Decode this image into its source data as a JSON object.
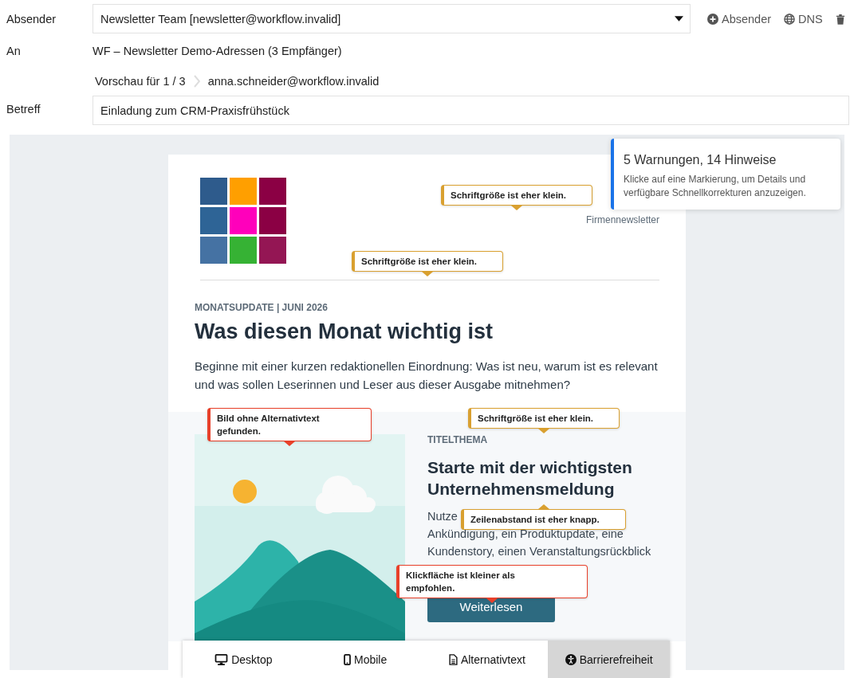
{
  "form": {
    "sender_label": "Absender",
    "sender_value": "Newsletter Team [newsletter@workflow.invalid]",
    "actions": [
      {
        "kind": "add",
        "label": "Absender"
      },
      {
        "kind": "globe",
        "label": "DNS"
      },
      {
        "kind": "delete"
      }
    ],
    "recipient_label": "An",
    "recipient_value": "WF – Newsletter Demo-Adressen (3 Empfänger)",
    "preview_for": "Vorschau für 1 / 3",
    "preview_address": "anna.schneider@workflow.invalid",
    "subject_label": "Betreff",
    "subject_value": "Einladung zum CRM-Praxisfrühstück"
  },
  "email": {
    "brand_line": "Firmennewsletter",
    "eyebrow": "MONATSUPDATE | JUNI 2026",
    "heading": "Was diesen Monat wichtig ist",
    "intro_lines": [
      "Beginne mit einer kurzen redaktionellen Einordnung: Was ist neu, warum ist es relevant",
      "und was sollen Leserinnen und Leser aus dieser Ausgabe mitnehmen?"
    ],
    "feature": {
      "image": {
        "kind": "picture"
      },
      "eyebrow": "TITELTHEMA",
      "heading": "Starte mit der wichtigsten Unternehmensmeldung",
      "body_lines": [
        "Nutze",
        "Ankündigung, ein Produktupdate, eine",
        "Kundenstory, einen Veranstaltungsrückblick"
      ],
      "button": "Weiterlesen"
    }
  },
  "annotations": [
    {
      "text": "Schriftgröße ist eher klein.",
      "kind": "warning"
    },
    {
      "text": "Schriftgröße ist eher klein.",
      "kind": "warning"
    },
    {
      "text": "Bild ohne Alternativtext gefunden.",
      "kind": "error"
    },
    {
      "text": "Schriftgröße ist eher klein.",
      "kind": "warning"
    },
    {
      "text": "Zeilenabstand ist eher knapp.",
      "kind": "warning"
    },
    {
      "text": "Klickfläche ist kleiner als empfohlen.",
      "kind": "error"
    }
  ],
  "summary": {
    "title": "5 Warnungen, 14 Hinweise",
    "text": "Klicke auf eine Markierung, um Details und verfügbare Schnellkorrekturen anzuzeigen."
  },
  "tabs": [
    {
      "label": "Desktop",
      "selected": false
    },
    {
      "label": "Mobile",
      "selected": false
    },
    {
      "label": "Alternativtext",
      "selected": false
    },
    {
      "label": "Barrierefreiheit",
      "selected": true
    }
  ]
}
